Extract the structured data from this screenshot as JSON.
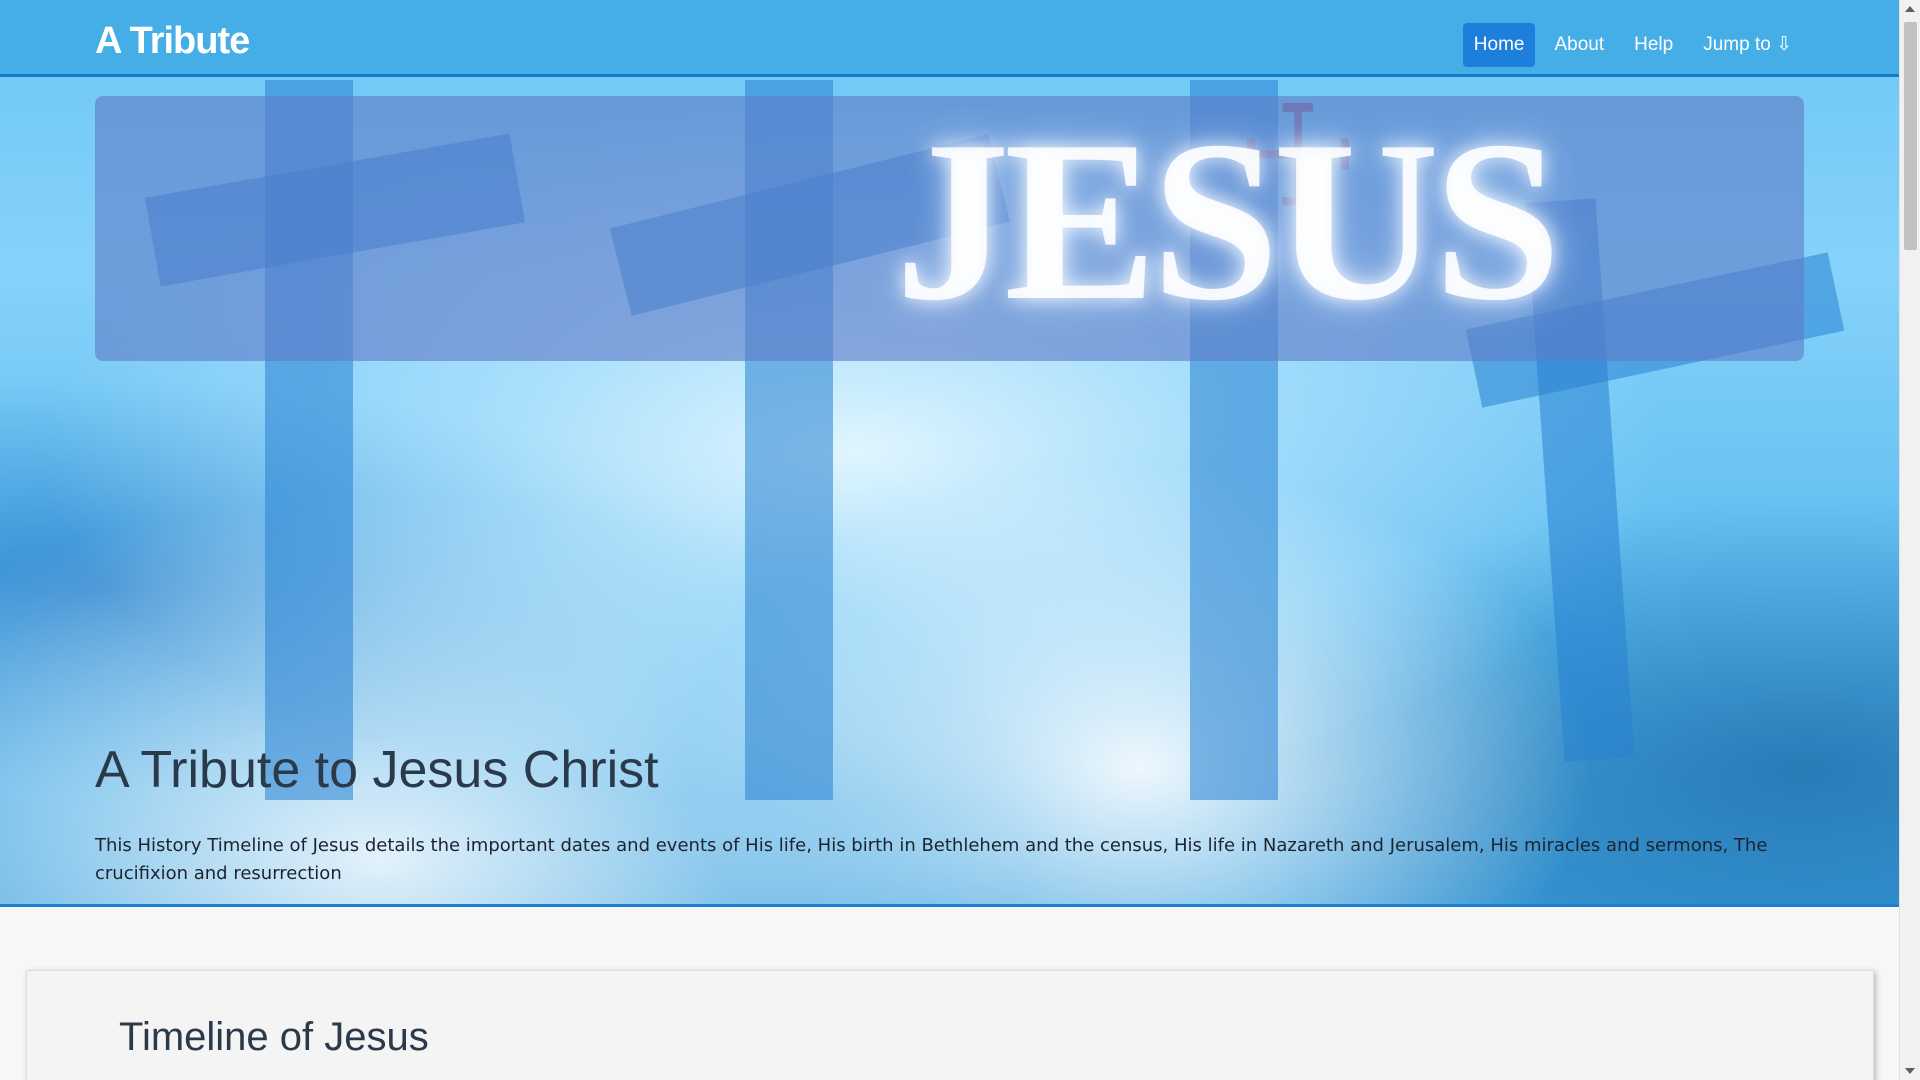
{
  "navbar": {
    "brand": "A Tribute",
    "items": [
      {
        "label": "Home",
        "active": true
      },
      {
        "label": "About",
        "active": false
      },
      {
        "label": "Help",
        "active": false
      },
      {
        "label": "Jump to ⇩",
        "active": false
      }
    ]
  },
  "banner": {
    "word": "JESUS"
  },
  "hero": {
    "title": "A Tribute to Jesus Christ",
    "description": "This History Timeline of Jesus details the important dates and events of His life, His birth in Bethlehem and the census, His life in Nazareth and Jerusalem, His miracles and sermons, The crucifixion and resurrection"
  },
  "card": {
    "title": "Timeline of Jesus"
  },
  "colors": {
    "navbar": "#45aee6",
    "active_nav": "#1c7fdb",
    "accent_border": "#1e78c8"
  }
}
